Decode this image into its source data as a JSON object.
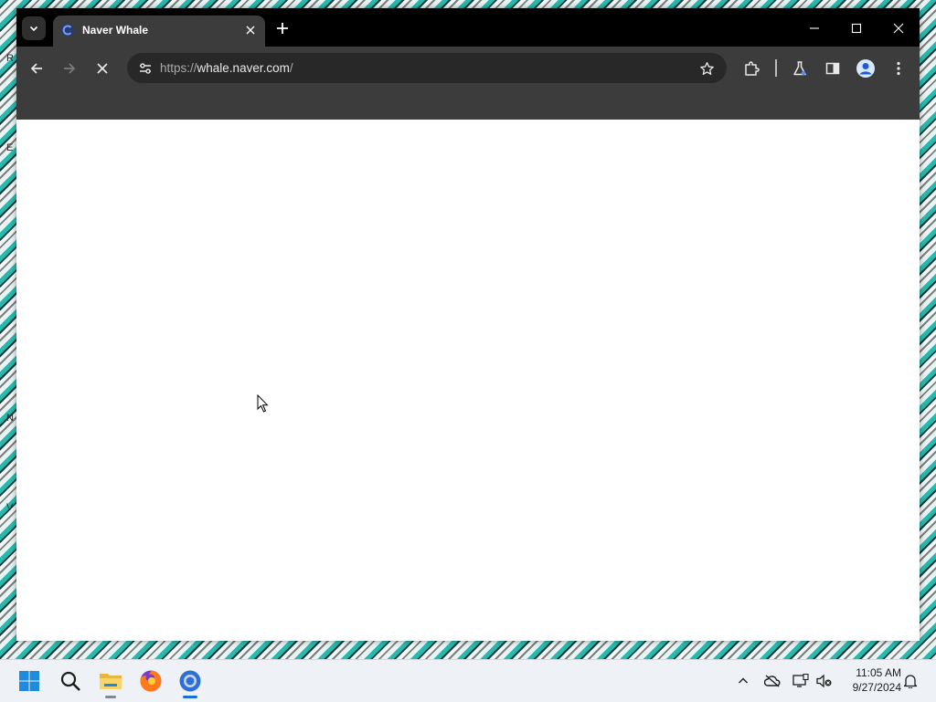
{
  "desktop": {
    "letters": [
      "R",
      "E",
      "N",
      "V"
    ]
  },
  "browser": {
    "tab": {
      "title": "Naver Whale",
      "favicon": "whale-favicon-icon"
    },
    "new_tab_icon": "plus-icon",
    "window_controls": [
      "minimize-icon",
      "maximize-icon",
      "close-icon"
    ],
    "toolbar": {
      "back_icon": "arrow-left-icon",
      "forward_icon": "arrow-right-icon",
      "stop_icon": "close-icon",
      "site_info_icon": "tune-icon",
      "url_prefix": "https://",
      "url_host": "whale.naver.com",
      "url_suffix": "/",
      "bookmark_icon": "star-outline-icon",
      "extensions_icon": "puzzle-icon",
      "labs_icon": "flask-icon",
      "sidepanel_icon": "side-panel-icon",
      "profile_icon": "avatar-icon",
      "menu_icon": "kebab-menu-icon"
    },
    "colors": {
      "tabstrip": "#000000",
      "toolbar": "#3c3c3c",
      "omnibox": "#282828",
      "page": "#ffffff"
    }
  },
  "taskbar": {
    "apps": [
      "windows-start-icon",
      "search-icon",
      "file-explorer-icon",
      "firefox-icon",
      "chrome-icon"
    ],
    "active_app": "chrome-icon",
    "tray": [
      "chevron-up-icon",
      "onedrive-offline-icon",
      "network-display-icon",
      "volume-muted-icon",
      "notification-bell-icon"
    ],
    "clock": {
      "time": "11:05 AM",
      "date": "9/27/2024"
    }
  }
}
